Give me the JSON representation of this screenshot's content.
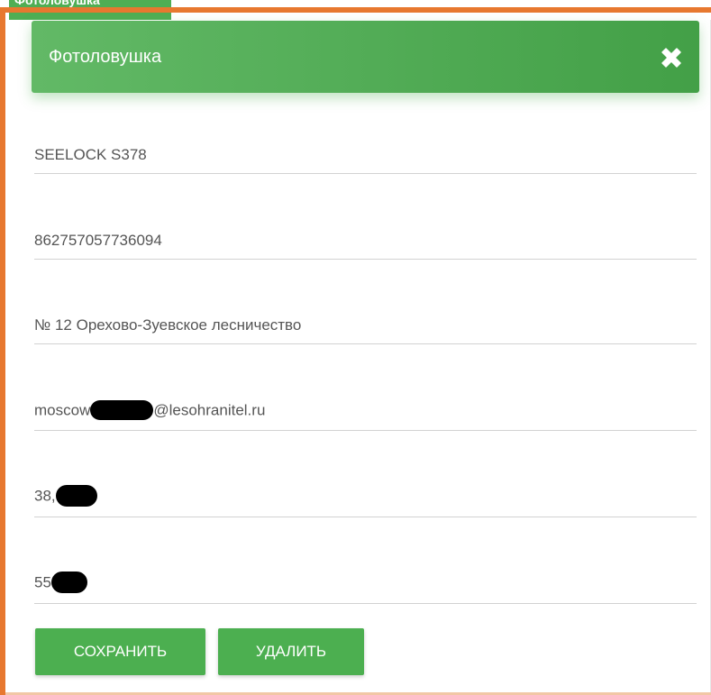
{
  "background_tab": {
    "label": "Фотоловушка"
  },
  "dialog": {
    "title": "Фотоловушка",
    "close_icon": "close-x-icon"
  },
  "fields": [
    {
      "value": "SEELOCK S378"
    },
    {
      "value": "862757057736094"
    },
    {
      "value": "№ 12 Орехово-Зуевское лесничество"
    },
    {
      "value_prefix": "moscow",
      "value_suffix": "@lesohranitel.ru",
      "redacted": true
    },
    {
      "value_prefix": "38,",
      "value_suffix": "",
      "redacted": true
    },
    {
      "value_prefix": "55",
      "value_suffix": "",
      "redacted": true
    }
  ],
  "buttons": {
    "save_label": "СОХРАНИТЬ",
    "delete_label": "УДАЛИТЬ"
  },
  "colors": {
    "header_green": "#4caf50",
    "button_green": "#4caf50",
    "annotation_orange": "#e7782f"
  }
}
